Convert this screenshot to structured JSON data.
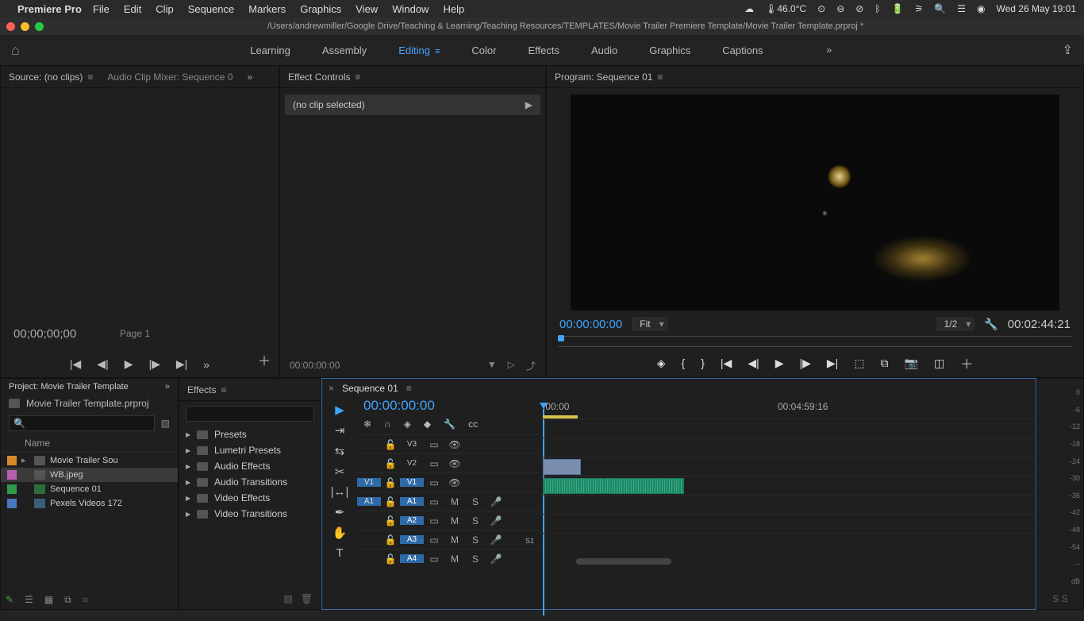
{
  "menubar": {
    "app_name": "Premiere Pro",
    "items": [
      "File",
      "Edit",
      "Clip",
      "Sequence",
      "Markers",
      "Graphics",
      "View",
      "Window",
      "Help"
    ],
    "status_temp": "46.0°C",
    "status_date": "Wed 26 May  19:01"
  },
  "titlebar_path": "/Users/andrewmiller/Google Drive/Teaching & Learning/Teaching Resources/TEMPLATES/Movie Trailer Premiere Template/Movie Trailer Template.prproj *",
  "workspaces": {
    "items": [
      "Learning",
      "Assembly",
      "Editing",
      "Color",
      "Effects",
      "Audio",
      "Graphics",
      "Captions"
    ],
    "active_index": 2,
    "overflow": "»"
  },
  "source_panel": {
    "tab_source": "Source: (no clips)",
    "tab_mixer": "Audio Clip Mixer: Sequence 0",
    "more": "»",
    "timecode": "00;00;00;00",
    "page_label": "Page 1"
  },
  "effect_controls": {
    "tab": "Effect Controls",
    "no_clip": "(no clip selected)",
    "timecode": "00:00:00:00"
  },
  "program": {
    "tab": "Program: Sequence 01",
    "timecode": "00:00:00:00",
    "fit": "Fit",
    "zoom": "1/2",
    "duration": "00:02:44:21"
  },
  "project": {
    "tab": "Project: Movie Trailer Template",
    "more": "»",
    "bin_name": "Movie Trailer Template.prproj",
    "search_placeholder": "",
    "col_name": "Name",
    "items": [
      {
        "color": "#d78a2a",
        "name": "Movie Trailer Sou",
        "kind": "folder",
        "expandable": true
      },
      {
        "color": "#b85fb0",
        "name": "WB.jpeg",
        "kind": "image"
      },
      {
        "color": "#2f9a4a",
        "name": "Sequence 01",
        "kind": "sequence"
      },
      {
        "color": "#4a78c0",
        "name": "Pexels Videos 172",
        "kind": "video"
      }
    ]
  },
  "effects_browser": {
    "tab": "Effects",
    "search_placeholder": "",
    "folders": [
      "Presets",
      "Lumetri Presets",
      "Audio Effects",
      "Audio Transitions",
      "Video Effects",
      "Video Transitions"
    ]
  },
  "timeline": {
    "sequence_name": "Sequence 01",
    "timecode": "00:00:00:00",
    "ruler_labels": [
      ":00:00",
      "00:04:59:16"
    ],
    "video_tracks": [
      {
        "src": "",
        "label": "V3"
      },
      {
        "src": "",
        "label": "V2"
      },
      {
        "src": "V1",
        "label": "V1",
        "source_on": true
      }
    ],
    "audio_tracks": [
      {
        "src": "A1",
        "label": "A1",
        "source_on": true,
        "m": "M",
        "s": "S"
      },
      {
        "src": "",
        "label": "A2",
        "m": "M",
        "s": "S"
      },
      {
        "src": "",
        "label": "A3",
        "m": "M",
        "s": "S"
      },
      {
        "src": "",
        "label": "A4",
        "m": "M",
        "s": "S"
      }
    ],
    "solo_badge": "S1",
    "tools": [
      "pointer",
      "track-select",
      "ripple",
      "razor",
      "slip",
      "pen",
      "hand",
      "type"
    ]
  },
  "meter": {
    "marks": [
      "0",
      "-6",
      "-12",
      "-18",
      "-24",
      "-30",
      "-36",
      "-42",
      "-48",
      "-54",
      "--",
      "dB"
    ],
    "footer": "S  S"
  }
}
